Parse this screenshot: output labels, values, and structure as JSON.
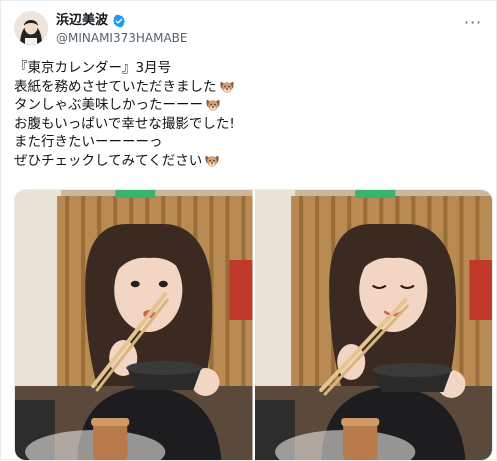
{
  "tweet": {
    "author": {
      "display_name": "浜辺美波",
      "handle": "@MINAMI373HAMABE",
      "avatar_icon": "user-avatar",
      "verified_icon": "verified-badge-icon",
      "verified_color": "#1d9bf0"
    },
    "more_label": "···",
    "text_lines": [
      {
        "text": "『東京カレンダー』3月号",
        "emoji": null
      },
      {
        "text": "表紙を務めさせていただきました",
        "emoji": "dog-face-emoji"
      },
      {
        "text": "タンしゃぶ美味しかったーーー",
        "emoji": "dog-face-emoji"
      },
      {
        "text": "お腹もいっぱいで幸せな撮影でした!",
        "emoji": null
      },
      {
        "text": "また行きたいーーーーっ",
        "emoji": null
      },
      {
        "text": "ぜひチェックしてみてください",
        "emoji": "dog-face-emoji"
      }
    ],
    "photos": [
      {
        "name": "photo-eating-chopsticks",
        "eyes": "open"
      },
      {
        "name": "photo-eating-eyes-closed",
        "eyes": "closed"
      }
    ]
  }
}
